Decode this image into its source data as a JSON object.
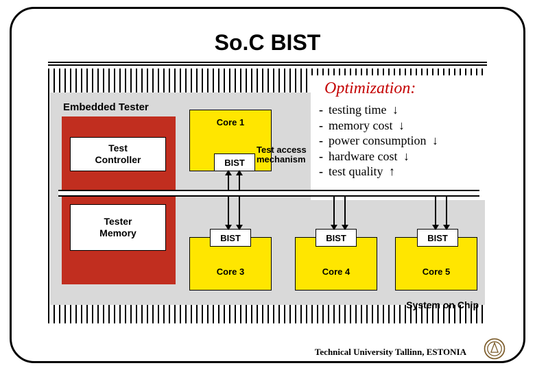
{
  "title": "So.C BIST",
  "optimization": {
    "heading": "Optimization:",
    "items": [
      {
        "label": "testing time",
        "arrow": "↓"
      },
      {
        "label": "memory cost",
        "arrow": "↓"
      },
      {
        "label": "power consumption",
        "arrow": "↓"
      },
      {
        "label": "hardware cost",
        "arrow": "↓"
      },
      {
        "label": "test quality",
        "arrow": "↑"
      }
    ]
  },
  "tester": {
    "embedded_label": "Embedded Tester",
    "controller_label": "Test\nController",
    "memory_label": "Tester\nMemory"
  },
  "test_access_label": "Test access\nmechanism",
  "bist_label": "BIST",
  "cores": {
    "core1": "Core 1",
    "core3": "Core 3",
    "core4": "Core 4",
    "core5": "Core 5"
  },
  "soc_label": "System on Chip",
  "footer": "Technical University Tallinn, ESTONIA"
}
